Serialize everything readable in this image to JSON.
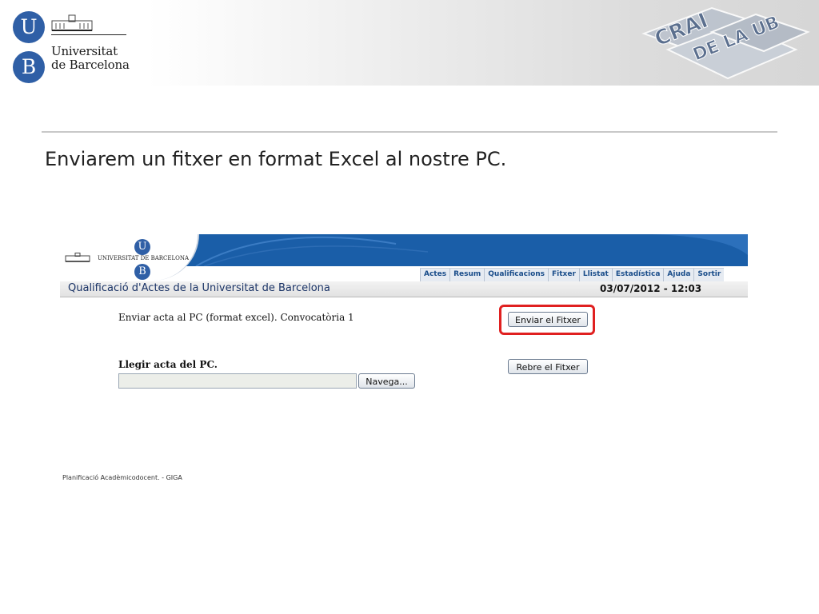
{
  "slide": {
    "university_logo": {
      "line1": "Universitat",
      "line2": "de Barcelona",
      "letters": [
        "U",
        "B"
      ]
    },
    "crai_logo": {
      "line1": "CRAI",
      "line2": "DE LA UB"
    },
    "title": "Enviarem un fitxer en format Excel al nostre PC."
  },
  "app": {
    "logo": {
      "text": "UNIVERSITAT DE BARCELONA",
      "letters": [
        "U",
        "B"
      ]
    },
    "nav": [
      "Actes",
      "Resum",
      "Qualificacions",
      "Fitxer",
      "Llistat",
      "Estadística",
      "Ajuda",
      "Sortir"
    ],
    "title": "Qualificació d'Actes de la Universitat de Barcelona",
    "datetime": "03/07/2012 - 12:03",
    "send": {
      "label": "Enviar acta al PC (format excel). Convocatòria 1",
      "button": "Enviar el Fitxer"
    },
    "read": {
      "label": "Llegir acta del PC.",
      "file_value": "",
      "browse_button": "Navega...",
      "receive_button": "Rebre el Fitxer"
    },
    "footer": "Planificació Acadèmicodocent. - GIGA"
  },
  "colors": {
    "ub_blue": "#2f5fa6",
    "banner_blue": "#1a5ea8",
    "highlight_red": "#e02020"
  }
}
